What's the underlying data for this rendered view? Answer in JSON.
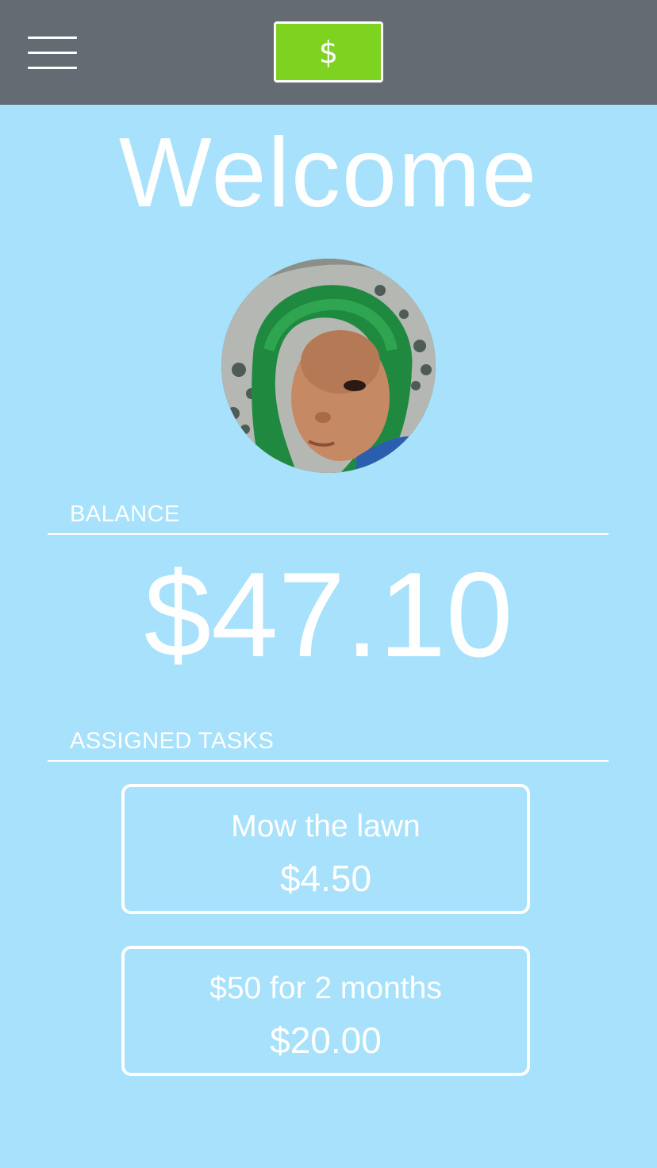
{
  "header": {
    "menu_icon": "hamburger-menu-icon",
    "dollar_label": "$",
    "bar_color": "#646b72",
    "accent_color": "#7ed321"
  },
  "welcome": {
    "title": "Welcome"
  },
  "profile": {
    "avatar_icon": "child-profile-photo"
  },
  "balance": {
    "label": "BALANCE",
    "amount": "$47.10"
  },
  "tasks": {
    "label": "ASSIGNED TASKS",
    "items": [
      {
        "title": "Mow the lawn",
        "amount": "$4.50"
      },
      {
        "title": "$50 for 2 months",
        "amount": "$20.00"
      }
    ]
  },
  "theme": {
    "background_color": "#a7e1fb"
  }
}
